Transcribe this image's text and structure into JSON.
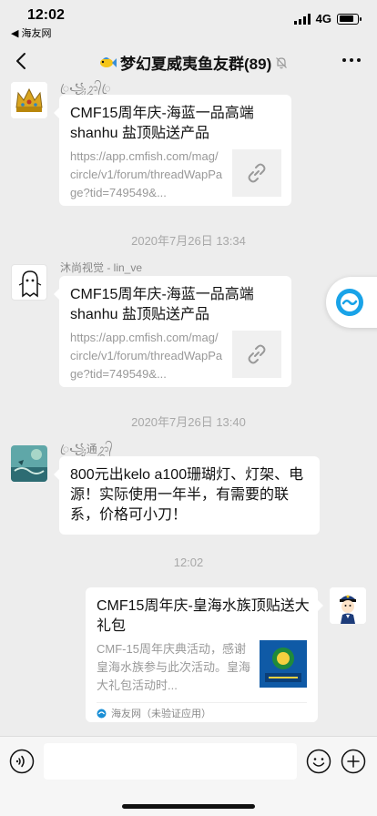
{
  "status_bar": {
    "time": "12:02",
    "back_app": "◀ 海友网",
    "network": "4G",
    "battery_level": 0.8
  },
  "navbar": {
    "title": "梦幻夏威夷鱼友群(89)"
  },
  "messages": [
    {
      "sender": "ꦿ꧁ᬊ᭄ꦿ",
      "link_title": "CMF15周年庆-海蓝一品高端shanhu 盐顶贴送产品",
      "link_url": "https://app.cmfish.com/mag/circle/v1/forum/threadWapPage?tid=749549&..."
    },
    {
      "timestamp": "2020年7月26日 13:34",
      "sender": "沐尚视觉 - lin_ve",
      "link_title": "CMF15周年庆-海蓝一品高端shanhu 盐顶贴送产品",
      "link_url": "https://app.cmfish.com/mag/circle/v1/forum/threadWapPage?tid=749549&..."
    },
    {
      "timestamp": "2020年7月26日 13:40",
      "sender": "ꦿ꧁通ᬊ᭄",
      "text": "800元出kelo a100珊瑚灯、灯架、电源！实际使用一年半，有需要的联系，价格可小刀！"
    },
    {
      "timestamp": "12:02",
      "card_title": "CMF15周年庆-皇海水族顶贴送大礼包",
      "card_desc": "CMF-15周年庆典活动，感谢皇海水族参与此次活动。皇海大礼包活动时...",
      "card_source": "海友网（未验证应用）"
    }
  ],
  "input_bar": {
    "placeholder": ""
  }
}
